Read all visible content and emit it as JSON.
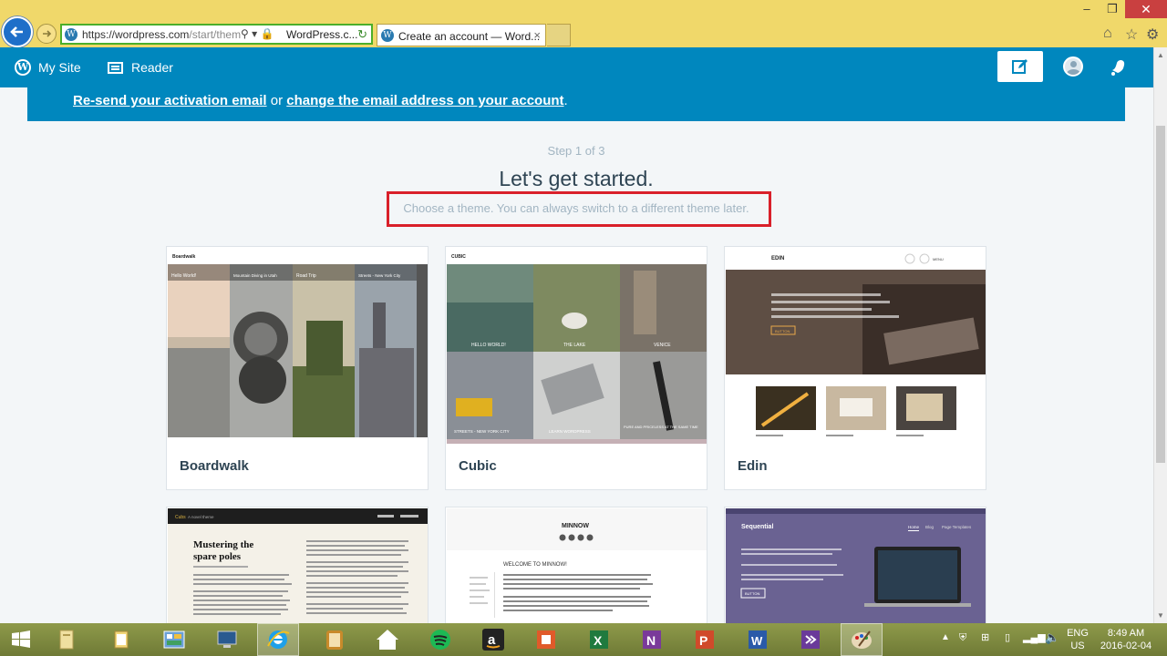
{
  "browser": {
    "url_host": "https://wordpress.com",
    "url_path": "/start/them",
    "site_identity": "WordPress.c...",
    "tab_title": "Create an account — Word...",
    "tab_close": "×",
    "icons": [
      "back-icon",
      "forward-icon",
      "search-icon",
      "lock-icon",
      "refresh-icon",
      "home-icon",
      "favorites-star-icon",
      "settings-gear-icon"
    ]
  },
  "masterbar": {
    "my_site": "My Site",
    "reader": "Reader"
  },
  "notice": {
    "link1": "Re-send your activation email",
    "middle": " or ",
    "link2": "change the email address on your account",
    "end": "."
  },
  "signup": {
    "step": "Step 1 of 3",
    "heading": "Let's get started.",
    "subheading": "Choose a theme. You can always switch to a different theme later."
  },
  "themes": [
    {
      "name": "Boardwalk",
      "preview_text": [
        "Boardwalk",
        "Hello World!",
        "Mountain Diving in Utah",
        "Road Trip",
        "Streets - New York City"
      ]
    },
    {
      "name": "Cubic",
      "preview_text": [
        "CUBIC",
        "HELLO WORLD!",
        "THE LAKE",
        "VENICE",
        "STREETS - NEW YORK CITY",
        "LEARN WORDPRESS",
        "PURE AND PRICELESS AT THE SAME TIME"
      ]
    },
    {
      "name": "Edin",
      "preview_text": [
        "EDIN",
        "MENU",
        "BUTTON"
      ]
    },
    {
      "name": "",
      "preview_text": [
        "Cubs",
        "A novel theme",
        "Mustering the spare poles"
      ]
    },
    {
      "name": "",
      "preview_text": [
        "MINNOW",
        "WELCOME TO MINNOW!"
      ]
    },
    {
      "name": "",
      "preview_text": [
        "Sequential",
        "Home",
        "Blog",
        "Page Templates",
        "BUTTON"
      ]
    }
  ],
  "taskbar": {
    "language": "ENG",
    "region": "US",
    "time": "8:49 AM",
    "date": "2016-02-04",
    "apps": [
      "windows-start-icon",
      "file-explorer-icon",
      "folder-icon",
      "control-panel-icon",
      "computer-icon",
      "internet-explorer-icon",
      "notes-icon",
      "home-icon",
      "spotify-icon",
      "amazon-icon",
      "office-icon",
      "excel-icon",
      "onenote-icon",
      "powerpoint-icon",
      "word-icon",
      "visual-studio-icon",
      "paint-icon"
    ]
  },
  "colors": {
    "masterbar": "#0087be",
    "highlight_box": "#d9202a",
    "chrome": "#f0d86a"
  }
}
